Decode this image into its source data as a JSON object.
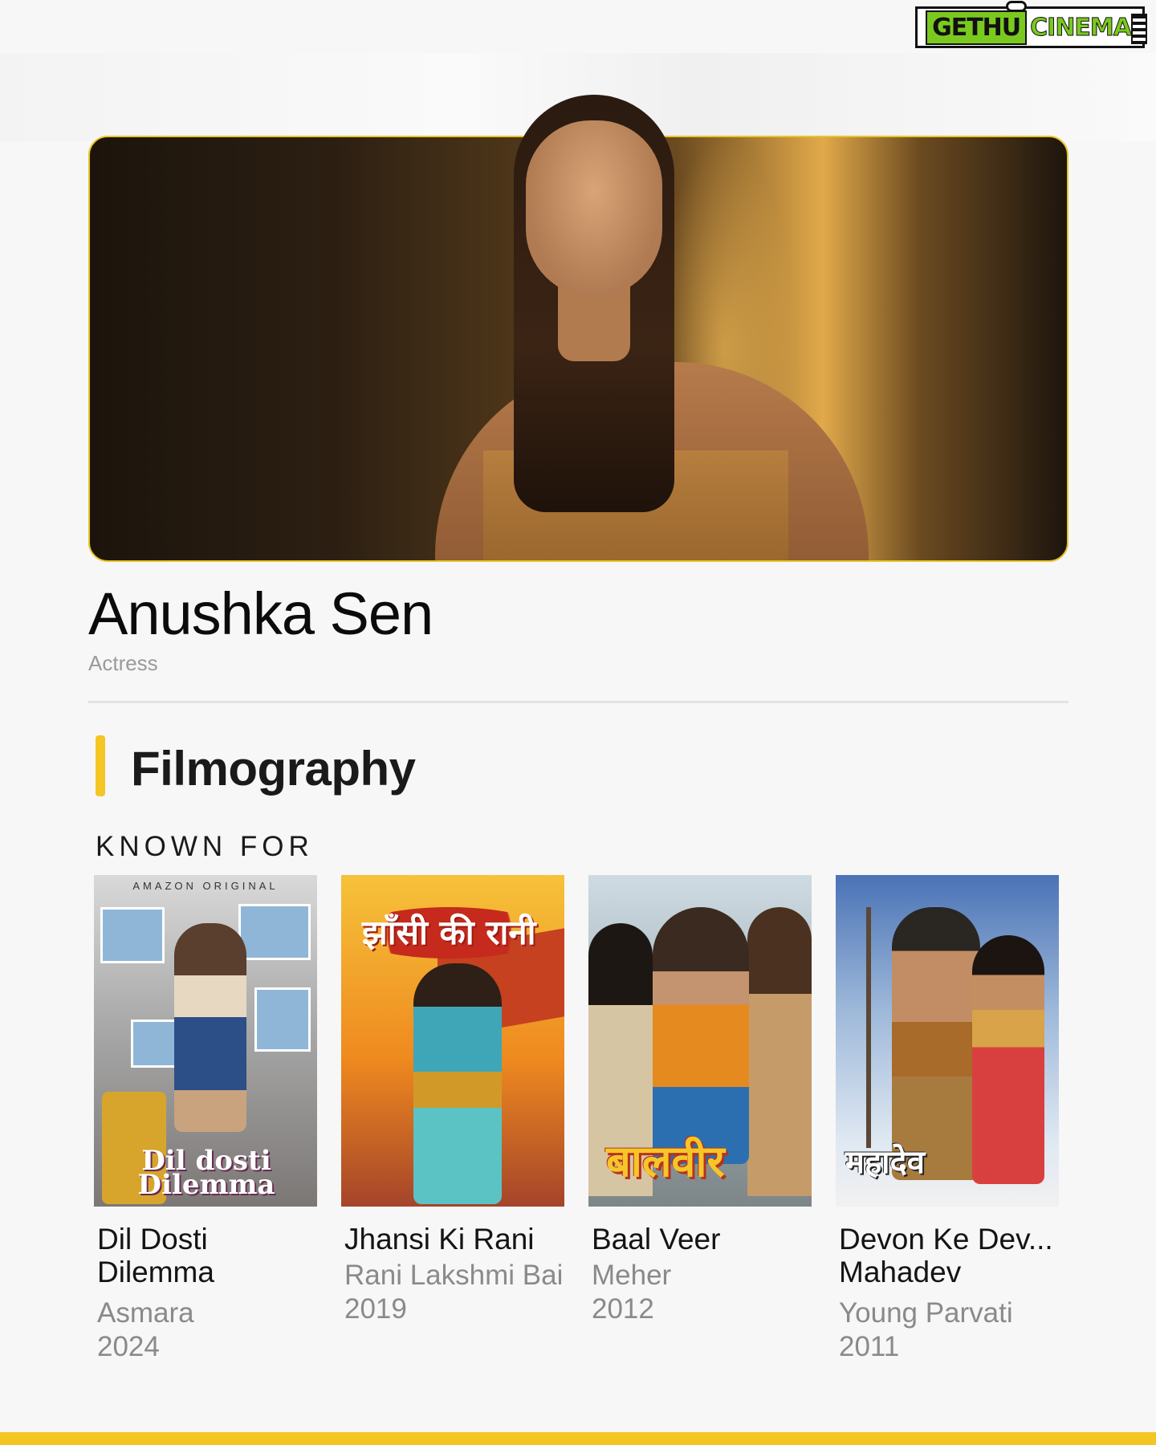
{
  "watermark": {
    "part1": "GETHU",
    "part2": "CINEMA"
  },
  "profile": {
    "name": "Anushka Sen",
    "role": "Actress"
  },
  "section": {
    "title": "Filmography",
    "subtitle": "KNOWN FOR"
  },
  "colors": {
    "accent": "#f3c623",
    "muted_text": "#8a8a8a"
  },
  "credits": [
    {
      "title": "Dil Dosti Dilemma",
      "character": "Asmara",
      "year": "2024",
      "poster_label": "AMAZON ORIGINAL",
      "poster_title": "Dil dosti Dilemma"
    },
    {
      "title": "Jhansi Ki Rani",
      "character": "Rani Lakshmi Bai",
      "year": "2019",
      "poster_title": "झाँसी की रानी"
    },
    {
      "title": "Baal Veer",
      "character": "Meher",
      "year": "2012",
      "poster_title": "बालवीर"
    },
    {
      "title": "Devon Ke Dev... Mahadev",
      "character": "Young Parvati",
      "year": "2011",
      "poster_title": "महादेव"
    }
  ]
}
